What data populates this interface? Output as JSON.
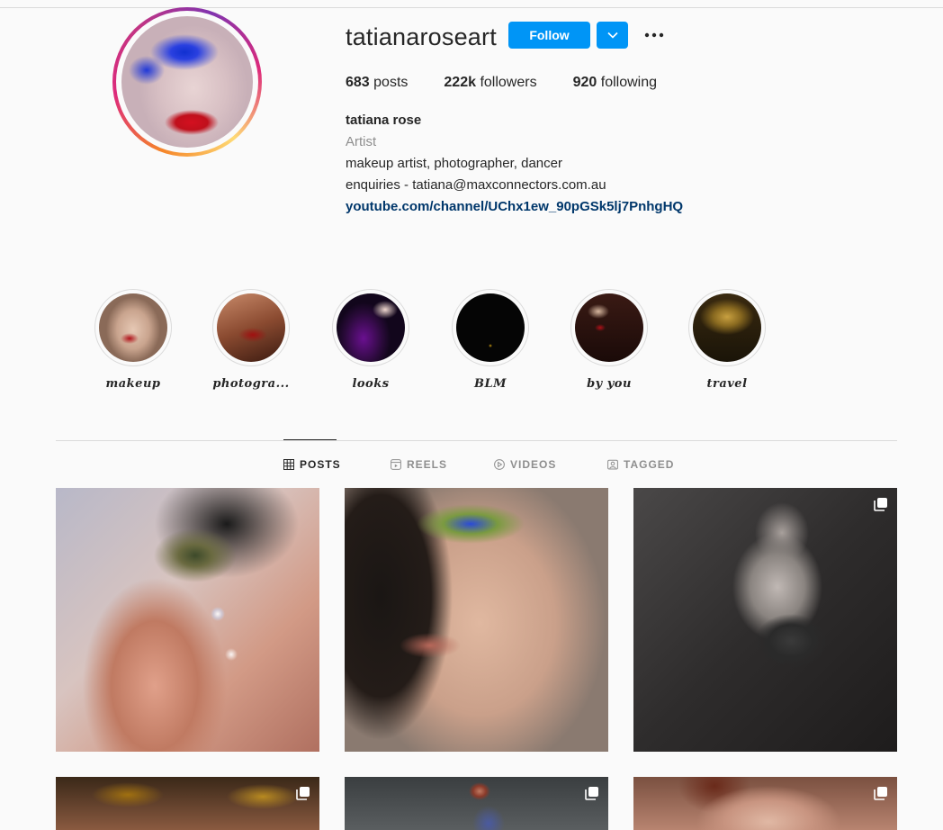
{
  "profile": {
    "username": "tatianaroseart",
    "follow_label": "Follow",
    "stats": {
      "posts_count": "683",
      "posts_label": "posts",
      "followers_count": "222k",
      "followers_label": "followers",
      "following_count": "920",
      "following_label": "following"
    },
    "full_name": "tatiana rose",
    "category": "Artist",
    "bio_line1": "makeup artist, photographer, dancer",
    "bio_line2": "enquiries - tatiana@maxconnectors.com.au",
    "link": "youtube.com/channel/UChx1ew_90pGSk5lj7PnhgHQ"
  },
  "highlights": [
    {
      "label": "makeup"
    },
    {
      "label": "photogra..."
    },
    {
      "label": "looks"
    },
    {
      "label": "BLM"
    },
    {
      "label": "by you"
    },
    {
      "label": "travel"
    }
  ],
  "tabs": [
    {
      "label": "POSTS",
      "icon": "grid-icon"
    },
    {
      "label": "REELS",
      "icon": "reels-icon"
    },
    {
      "label": "VIDEOS",
      "icon": "play-icon"
    },
    {
      "label": "TAGGED",
      "icon": "tagged-icon"
    }
  ],
  "colors": {
    "accent": "#0095f6",
    "link": "#00376b",
    "muted": "#8e8e8e"
  }
}
